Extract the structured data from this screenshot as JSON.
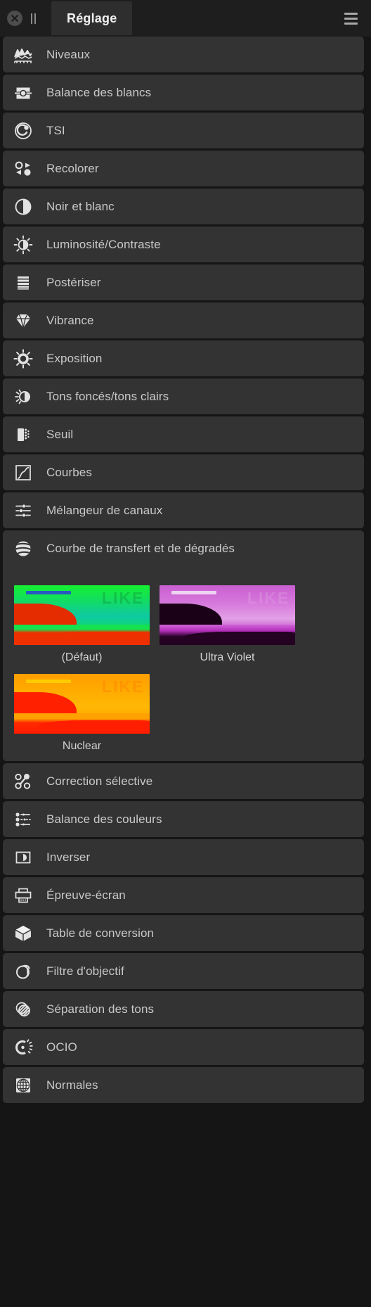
{
  "header": {
    "close_icon": "close-circle-icon",
    "pause_icon": "pause-icon",
    "tab_label": "Réglage",
    "menu_icon": "hamburger-menu-icon"
  },
  "adjustments": [
    {
      "label": "Niveaux",
      "icon": "levels-histogram-icon"
    },
    {
      "label": "Balance des blancs",
      "icon": "white-balance-icon"
    },
    {
      "label": "TSI",
      "icon": "hsl-wheel-icon"
    },
    {
      "label": "Recolorer",
      "icon": "recolor-icon"
    },
    {
      "label": "Noir et blanc",
      "icon": "black-and-white-icon"
    },
    {
      "label": "Luminosité/Contraste",
      "icon": "brightness-contrast-icon"
    },
    {
      "label": "Postériser",
      "icon": "posterize-icon"
    },
    {
      "label": "Vibrance",
      "icon": "vibrance-gem-icon"
    },
    {
      "label": "Exposition",
      "icon": "exposure-sun-icon"
    },
    {
      "label": "Tons foncés/tons clairs",
      "icon": "shadows-highlights-icon"
    },
    {
      "label": "Seuil",
      "icon": "threshold-icon"
    },
    {
      "label": "Courbes",
      "icon": "curves-icon"
    },
    {
      "label": "Mélangeur de canaux",
      "icon": "channel-mixer-icon"
    }
  ],
  "gradient_map": {
    "label": "Courbe de transfert et de dégradés",
    "icon": "gradient-map-sphere-icon",
    "presets": [
      {
        "name": "(Défaut)",
        "colors": {
          "sky_top": "#14f03c",
          "sky_bottom": "#0bd7a0",
          "hill": "#e82c00",
          "water": "#12e04a",
          "shore": "#ec3000",
          "bar": "#2c3fd8",
          "like": "#0f8a3c"
        }
      },
      {
        "name": "Ultra Violet",
        "colors": {
          "sky_top": "#d46ad8",
          "sky_bottom": "#c86ad0",
          "hill": "#1a0118",
          "water": "#c032c8",
          "shore": "#230222",
          "bar": "#f0e0f4",
          "like": "#e8b8ec"
        }
      },
      {
        "name": "Nuclear",
        "colors": {
          "sky_top": "#ffa000",
          "sky_bottom": "#ffb400",
          "hill": "#ff2000",
          "water": "#ffa000",
          "shore": "#ff1e00",
          "bar": "#ffd800",
          "like": "#ff6a00"
        }
      }
    ]
  },
  "adjustments_bottom": [
    {
      "label": "Correction sélective",
      "icon": "selective-color-icon"
    },
    {
      "label": "Balance des couleurs",
      "icon": "color-balance-icon"
    },
    {
      "label": "Inverser",
      "icon": "invert-icon"
    },
    {
      "label": "Épreuve-écran",
      "icon": "soft-proof-printer-icon"
    },
    {
      "label": "Table de conversion",
      "icon": "lut-cube-icon"
    },
    {
      "label": "Filtre d'objectif",
      "icon": "lens-filter-icon"
    },
    {
      "label": "Séparation des tons",
      "icon": "split-toning-icon"
    },
    {
      "label": "OCIO",
      "icon": "ocio-icon"
    },
    {
      "label": "Normales",
      "icon": "normals-globe-icon"
    }
  ],
  "theme": {
    "panel_bg": "#151515",
    "row_bg": "#333333",
    "header_bg": "#1e1e1e",
    "tab_bg": "#2e2e2e",
    "text": "#c9c9c9",
    "icon": "#e2e2e2"
  }
}
